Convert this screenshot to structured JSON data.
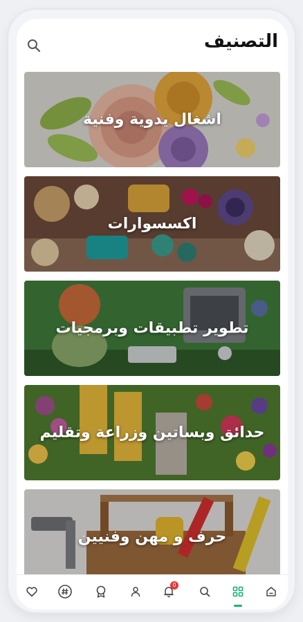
{
  "header": {
    "title": "التصنيف",
    "search_icon": "search-icon"
  },
  "categories": [
    {
      "label": "اشغال يدوية وفنية"
    },
    {
      "label": "اكسسوارات"
    },
    {
      "label": "تطوير تطبيقات وبرمجيات"
    },
    {
      "label": "حدائق وبساتين وزراعة وتقليم"
    },
    {
      "label": "حرف و مهن وفنيين"
    }
  ],
  "tabbar": {
    "active_tab": "categories",
    "accent_color": "#1bb36c",
    "badge_color": "#e53935",
    "tabs": [
      {
        "name": "home",
        "icon": "home-icon"
      },
      {
        "name": "categories",
        "icon": "grid-icon"
      },
      {
        "name": "search",
        "icon": "search-icon"
      },
      {
        "name": "notifications",
        "icon": "bell-icon",
        "badge": "0"
      },
      {
        "name": "profile",
        "icon": "person-icon"
      },
      {
        "name": "awards",
        "icon": "badge-icon"
      },
      {
        "name": "hashtag",
        "icon": "hashtag-icon"
      },
      {
        "name": "favorites",
        "icon": "heart-icon"
      }
    ]
  }
}
